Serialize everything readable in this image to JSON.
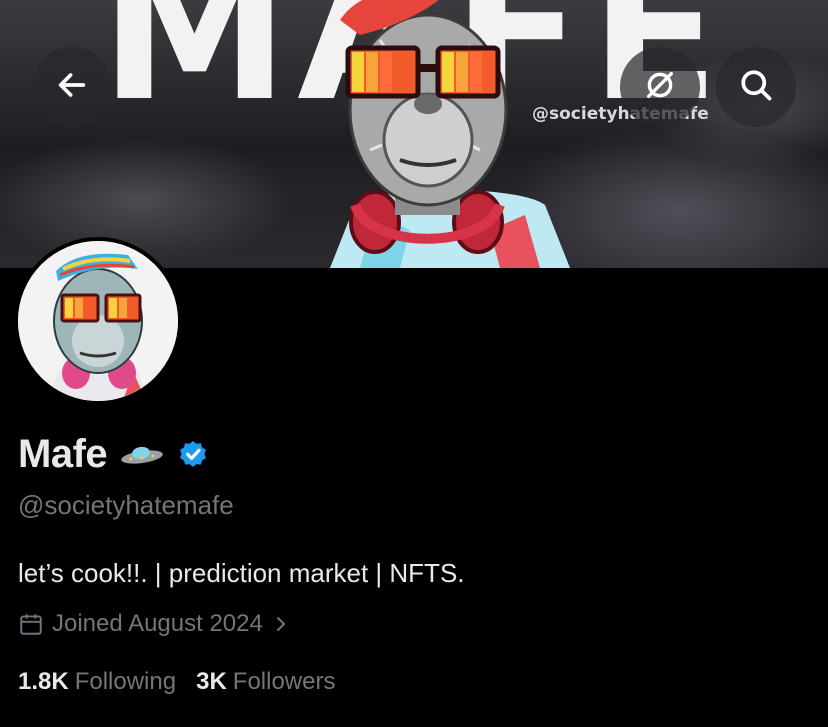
{
  "banner": {
    "headline": "MAFE",
    "overlay_handle": "@societyhatemafe"
  },
  "header_buttons": {
    "back": {
      "icon": "arrow-left-icon"
    },
    "grok": {
      "icon": "grok-slash-icon"
    },
    "search": {
      "icon": "search-icon"
    }
  },
  "profile": {
    "name": "Mafe",
    "name_emoji": "ufo-icon",
    "verified": true,
    "verified_color": "#1d9bf0",
    "handle": "@societyhatemafe",
    "bio": "let’s cook!!. | prediction market | NFTS.",
    "joined": "Joined August 2024",
    "following_count": "1.8K",
    "following_label": "Following",
    "followers_count": "3K",
    "followers_label": "Followers"
  }
}
